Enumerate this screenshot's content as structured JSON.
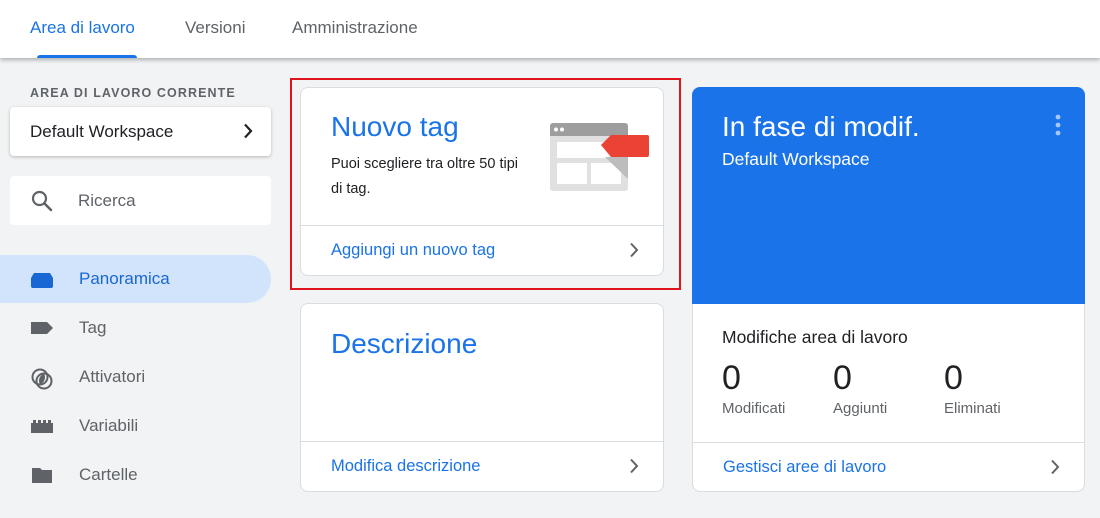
{
  "tabs": [
    {
      "label": "Area di lavoro",
      "active": true
    },
    {
      "label": "Versioni",
      "active": false
    },
    {
      "label": "Amministrazione",
      "active": false
    }
  ],
  "sidebar": {
    "section_label": "AREA DI LAVORO CORRENTE",
    "workspace_name": "Default Workspace",
    "search_placeholder": "Ricerca",
    "items": [
      {
        "label": "Panoramica",
        "icon": "overview-icon",
        "active": true
      },
      {
        "label": "Tag",
        "icon": "tag-icon",
        "active": false
      },
      {
        "label": "Attivatori",
        "icon": "trigger-icon",
        "active": false
      },
      {
        "label": "Variabili",
        "icon": "variables-icon",
        "active": false
      },
      {
        "label": "Cartelle",
        "icon": "folder-icon",
        "active": false
      }
    ]
  },
  "cards": {
    "new_tag": {
      "title": "Nuovo tag",
      "description": "Puoi scegliere tra oltre 50 tipi di tag.",
      "link": "Aggiungi un nuovo tag",
      "highlighted": true
    },
    "description": {
      "title": "Descrizione",
      "link": "Modifica descrizione"
    },
    "workspace": {
      "title": "In fase di modif.",
      "subtitle": "Default Workspace",
      "changes_title": "Modifiche area di lavoro",
      "stats": [
        {
          "value": "0",
          "label": "Modificati"
        },
        {
          "value": "0",
          "label": "Aggiunti"
        },
        {
          "value": "0",
          "label": "Eliminati"
        }
      ],
      "link": "Gestisci aree di lavoro"
    }
  },
  "colors": {
    "accent": "#1a73e8",
    "highlight_border": "#e0141b",
    "active_nav_bg": "#d2e3fc",
    "tag_red": "#ea4335"
  }
}
